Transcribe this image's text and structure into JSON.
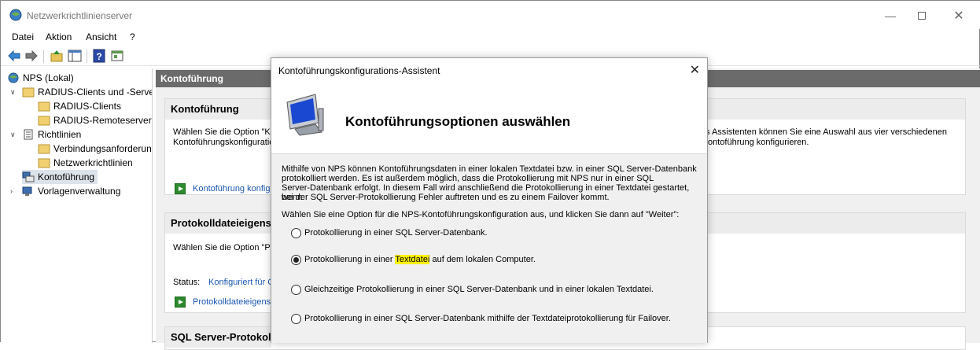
{
  "window": {
    "title": "Netzwerkrichtlinienserver"
  },
  "menu": [
    "Datei",
    "Aktion",
    "Ansicht",
    "?"
  ],
  "tree": {
    "root": "NPS (Lokal)",
    "radius_group": "RADIUS-Clients und -Server",
    "radius_clients": "RADIUS-Clients",
    "radius_remote": "RADIUS-Remoteservergruppen",
    "policies": "Richtlinien",
    "connection_requests": "Verbindungsanforderungsrichtlinien",
    "network_policies": "Netzwerkrichtlinien",
    "accounting": "Kontoführung",
    "templates": "Vorlagenverwaltung"
  },
  "content": {
    "header": "Kontoführung",
    "panel1": {
      "title": "Kontoführung",
      "text_left_1": "Wählen Sie die Option \"Kontoführung konfigurieren\" aus, um den Kontoführungskonfigurations-Assistenten zu starten. Mithilfe des",
      "text_left_2": "Kontoführungskonfiguration",
      "text_right_1": "s Assistenten können Sie eine Auswahl aus vier verschiedenen",
      "text_right_2": "ontoführung konfigurieren.",
      "link": "Kontoführung konfigurieren"
    },
    "panel2": {
      "title": "Protokolldateieigenschaften",
      "text": "Wählen Sie die Option \"Protokolldateieigenschaften ändern\" aus",
      "status_label": "Status:",
      "status_value": "Konfiguriert für C:",
      "link": "Protokolldateieigenschaften ändern"
    },
    "panel3": {
      "title": "SQL Server-Protokollierungseigenschaften"
    }
  },
  "dialog": {
    "title": "Kontoführungskonfigurations-Assistent",
    "heading": "Kontoführungsoptionen auswählen",
    "description": [
      "Mithilfe von NPS können Kontoführungsdaten in einer lokalen Textdatei bzw. in einer SQL Server-Datenbank",
      "protokolliert werden. Es ist außerdem möglich, dass die Protokollierung mit NPS nur in einer SQL",
      "Server-Datenbank erfolgt. In diesem Fall wird anschließend die Protokollierung in einer Textdatei gestartet, wenn",
      "bei der SQL Server-Protokollierung Fehler auftreten und es zu einem Failover kommt."
    ],
    "prompt": "Wählen Sie eine Option für die NPS-Kontoführungskonfiguration aus, und klicken Sie dann auf \"Weiter\":",
    "options": [
      {
        "label": "Protokollierung in einer SQL Server-Datenbank.",
        "selected": false
      },
      {
        "label_before": "Protokollierung in einer ",
        "label_highlight": "Textdatei",
        "label_after": " auf dem lokalen Computer.",
        "selected": true
      },
      {
        "label": "Gleichzeitige Protokollierung in einer SQL Server-Datenbank und in einer lokalen Textdatei.",
        "selected": false
      },
      {
        "label": "Protokollierung in einer SQL Server-Datenbank mithilfe der Textdateiprotokollierung für Failover.",
        "selected": false
      }
    ]
  }
}
